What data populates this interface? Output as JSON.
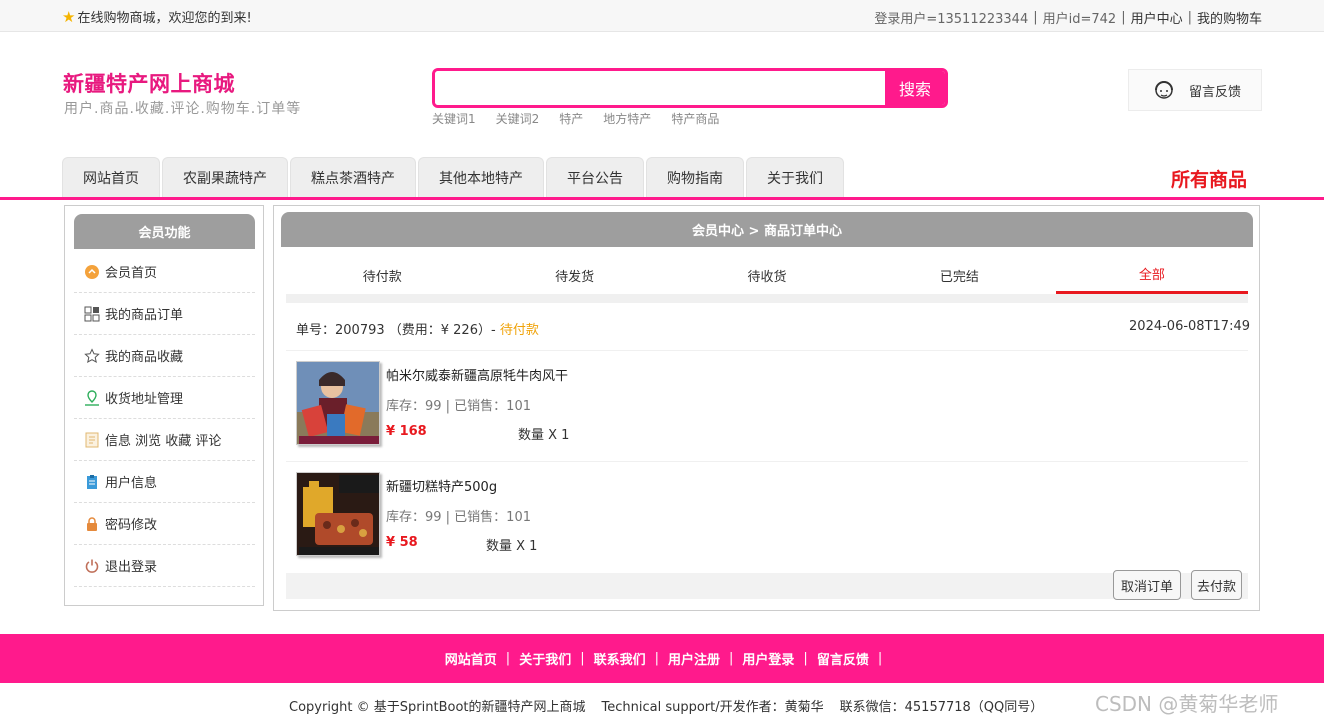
{
  "topbar": {
    "welcome": "在线购物商城，欢迎您的到来!",
    "login_user": "登录用户=13511223344",
    "user_id": "用户id=742",
    "user_center": "用户中心",
    "cart": "我的购物车"
  },
  "header": {
    "site_title": "新疆特产网上商城",
    "subtitle": "用户.商品.收藏.评论.购物车.订单等",
    "search_placeholder": "",
    "search_button": "搜索",
    "hotwords": [
      "关键词1",
      "关键词2",
      "特产",
      "地方特产",
      "特产商品"
    ],
    "feedback": "留言反馈"
  },
  "nav": {
    "tabs": [
      "网站首页",
      "农副果蔬特产",
      "糕点茶酒特产",
      "其他本地特产",
      "平台公告",
      "购物指南",
      "关于我们"
    ],
    "all_goods": "所有商品"
  },
  "sidebar": {
    "title": "会员功能",
    "items": [
      {
        "label": "会员首页",
        "icon": "member-home-icon"
      },
      {
        "label": "我的商品订单",
        "icon": "orders-icon"
      },
      {
        "label": "我的商品收藏",
        "icon": "star-icon"
      },
      {
        "label": "收货地址管理",
        "icon": "location-icon"
      },
      {
        "label": "信息 浏览 收藏 评论",
        "icon": "document-icon"
      },
      {
        "label": "用户信息",
        "icon": "clipboard-icon"
      },
      {
        "label": "密码修改",
        "icon": "lock-icon"
      },
      {
        "label": "退出登录",
        "icon": "power-icon"
      }
    ]
  },
  "main": {
    "breadcrumb": "会员中心 > 商品订单中心",
    "tabs": [
      "待付款",
      "待发货",
      "待收货",
      "已完结",
      "全部"
    ],
    "active_tab": "全部",
    "order": {
      "number_label": "单号：200793 （费用：¥ 226）- ",
      "status": "待付款",
      "datetime": "2024-06-08T17:49"
    },
    "items": [
      {
        "name": "帕米尔威泰新疆高原牦牛肉风干",
        "stock": "库存：99 | 已销售：101",
        "price": "¥ 168",
        "qty": "数量 X 1"
      },
      {
        "name": "新疆切糕特产500g",
        "stock": "库存：99 | 已销售：101",
        "price": "¥ 58",
        "qty": "数量 X 1"
      }
    ],
    "cancel_button": "取消订单",
    "pay_button": "去付款"
  },
  "footer": {
    "links": [
      "网站首页",
      "关于我们",
      "联系我们",
      "用户注册",
      "用户登录",
      "留言反馈"
    ],
    "copyright": "Copyright © 基于SprintBoot的新疆特产网上商城",
    "support": "Technical support/开发作者：黄菊华",
    "contact": "联系微信：45157718（QQ同号）",
    "watermark": "CSDN @黄菊华老师"
  },
  "colors": {
    "brand_pink": "#ff1a8c",
    "active_red": "#e8191f",
    "status_orange": "#f0a30a",
    "header_gray": "#9e9e9e"
  }
}
